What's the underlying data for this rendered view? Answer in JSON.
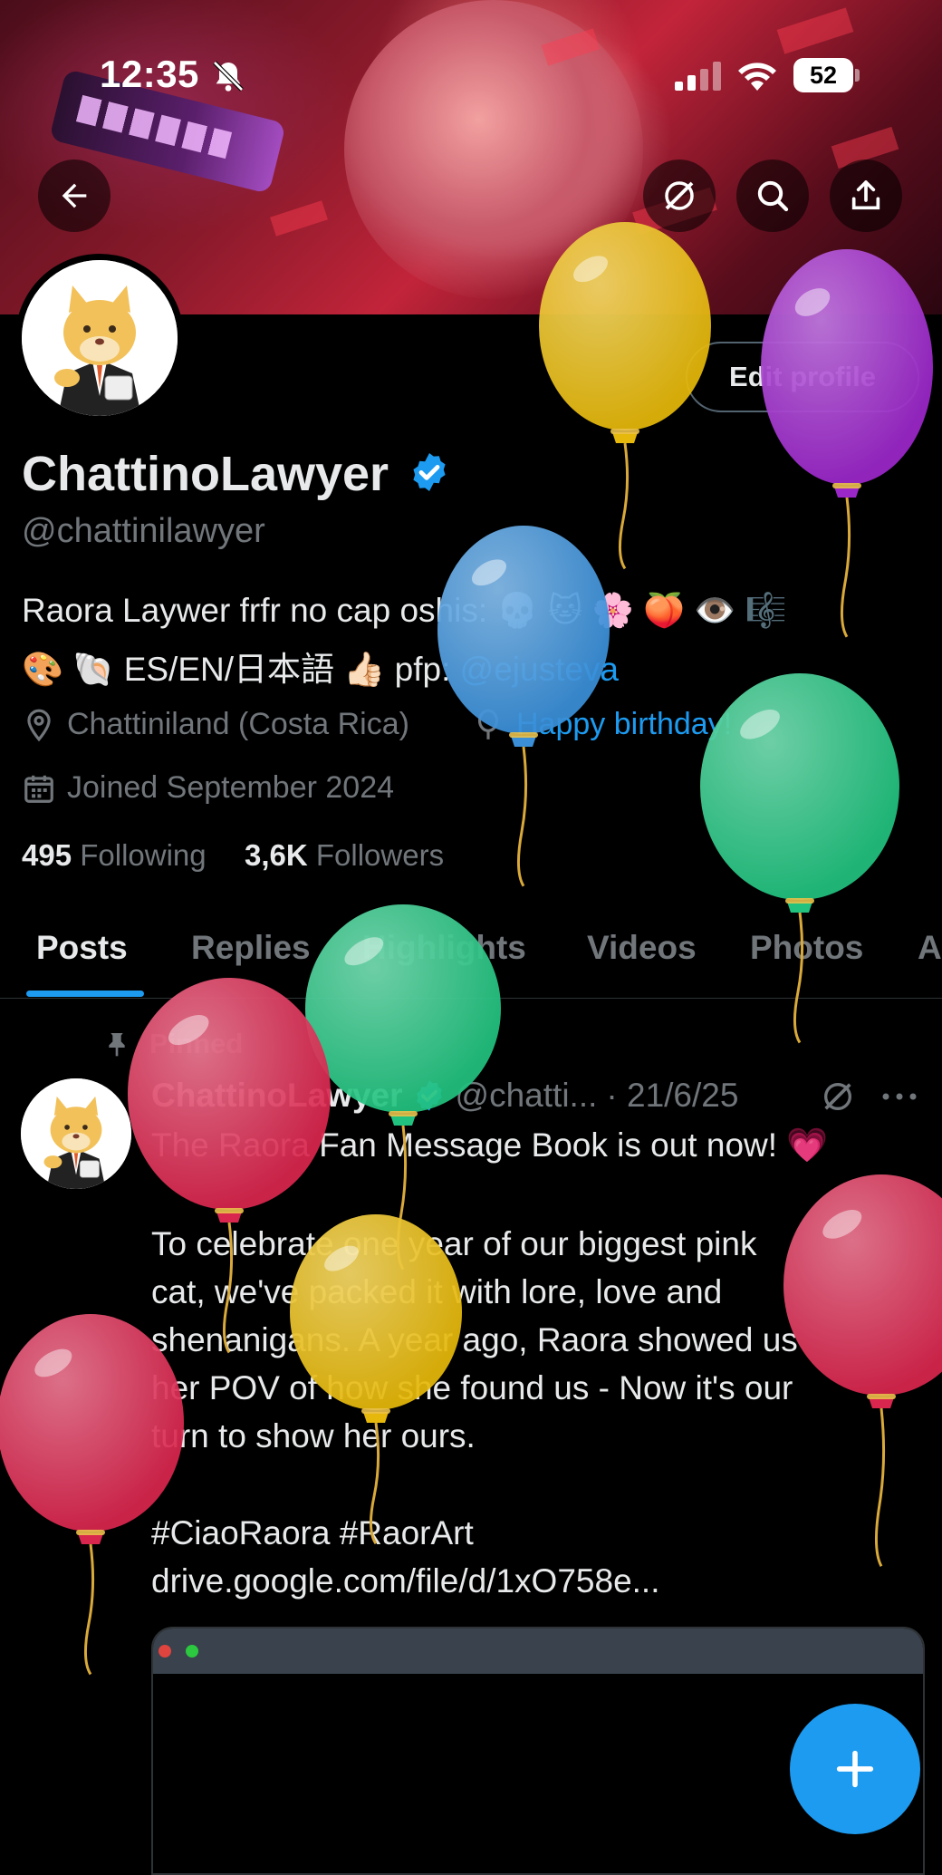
{
  "status_bar": {
    "time": "12:35",
    "battery": "52"
  },
  "profile": {
    "display_name": "ChattinoLawyer",
    "handle": "@chattinilawyer",
    "edit_label": "Edit profile",
    "bio_line1_text": "Raora Laywer frfr no cap oshis: 💀 🐱 🌸 🍑 👁️ 🎼",
    "bio_line2_text": "🎨 🐚 ES/EN/日本語 👍🏻 pfp: ",
    "bio_link": "@ejusteva",
    "location": "Chattiniland (Costa Rica)",
    "birthday": "Happy birthday!",
    "joined": "Joined September 2024",
    "following_count": "495",
    "following_label": "Following",
    "followers_count": "3,6K",
    "followers_label": "Followers"
  },
  "tabs": [
    {
      "label": "Posts"
    },
    {
      "label": "Replies"
    },
    {
      "label": "Highlights"
    },
    {
      "label": "Videos"
    },
    {
      "label": "Photos"
    },
    {
      "label": "A"
    }
  ],
  "post": {
    "pinned_label": "Pinned",
    "author": "ChattinoLawyer",
    "handle": "@chatti...",
    "date": "· 21/6/25",
    "line1": "The Raora Fan Message Book is out now! 💗",
    "line2": "To celebrate one year of our biggest pink",
    "line3": "cat, we've packed it with lore, love and",
    "line4": "shenanigans. A year ago, Raora showed us",
    "line5": "her POV of how she found us - Now it's our",
    "line6": "turn to show her ours.",
    "hashtags": "#CiaoRaora #RaorArt",
    "url": " drive.google.com/file/d/1xO758e..."
  },
  "colors": {
    "accent": "#1d9bf0",
    "muted": "#71767b",
    "text": "#e7e9ea",
    "balloon_yellow": "#e5b80b",
    "balloon_purple": "#9b27c9",
    "balloon_blue": "#3a8fd8",
    "balloon_green": "#21c27f",
    "balloon_red": "#d8264e"
  },
  "icons": [
    "back-arrow-icon",
    "grok-icon",
    "search-icon",
    "share-icon",
    "verified-icon",
    "location-icon",
    "balloon-icon",
    "calendar-icon",
    "pin-icon",
    "more-icon",
    "plus-icon"
  ]
}
